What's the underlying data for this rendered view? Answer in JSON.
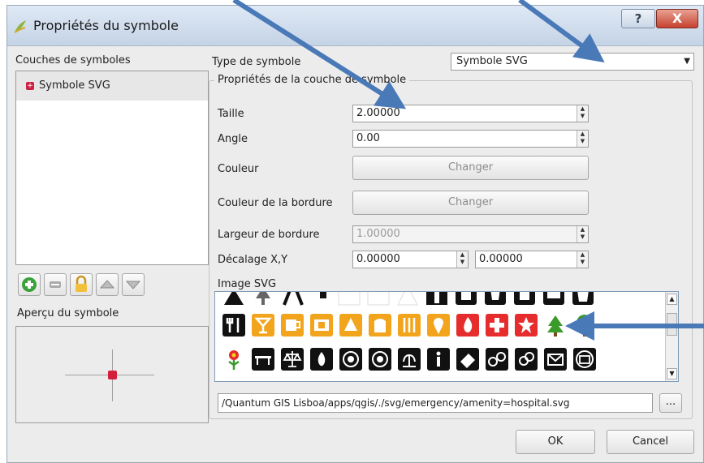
{
  "window": {
    "title": "Propriétés du symbole",
    "help": "?",
    "close": "X"
  },
  "left": {
    "layers_label": "Couches de symboles",
    "layer_item": "Symbole SVG",
    "preview_label": "Aperçu du symbole"
  },
  "right": {
    "type_label": "Type de symbole",
    "type_value": "Symbole SVG",
    "group_title": "Propriétés de la couche de symbole",
    "size_label": "Taille",
    "size_value": "2.00000",
    "angle_label": "Angle",
    "angle_value": "0.00",
    "color_label": "Couleur",
    "border_color_label": "Couleur de la bordure",
    "change_label": "Changer",
    "border_width_label": "Largeur de bordure",
    "border_width_value": "1.00000",
    "offset_label": "Décalage X,Y",
    "offset_x": "0.00000",
    "offset_y": "0.00000",
    "svg_label": "Image SVG",
    "path_value": "/Quantum GIS Lisboa/apps/qgis/./svg/emergency/amenity=hospital.svg",
    "browse_label": "..."
  },
  "footer": {
    "ok": "OK",
    "cancel": "Cancel"
  },
  "colors": {
    "accent": "#4477bb",
    "icon_orange": "#f2a41d",
    "icon_red": "#e62c2c",
    "icon_green": "#3a9a2a"
  }
}
